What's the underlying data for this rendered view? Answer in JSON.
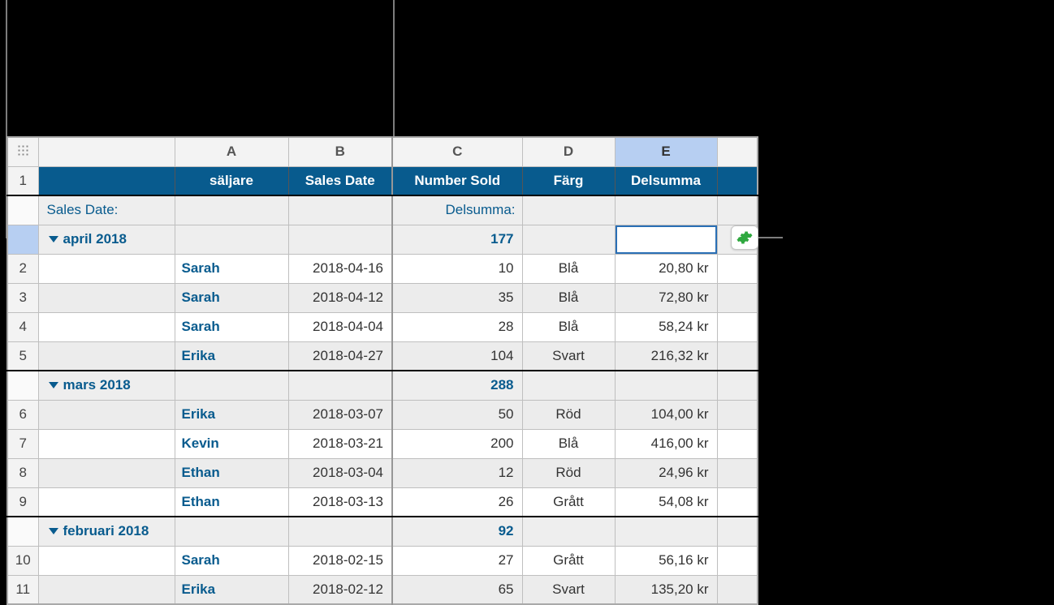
{
  "columns": {
    "letters": [
      "A",
      "B",
      "C",
      "D",
      "E"
    ],
    "selected_index": 4
  },
  "headers": {
    "label": "",
    "a": "säljare",
    "b": "Sales Date",
    "c": "Number Sold",
    "d": "Färg",
    "e": "Delsumma"
  },
  "summary_row": {
    "label": "Sales Date:",
    "sub_label": "Delsumma:"
  },
  "groups": [
    {
      "name": "april 2018",
      "subtotal_number": "177",
      "rows": [
        {
          "n": "2",
          "seller": "Sarah",
          "date": "2018-04-16",
          "num": "10",
          "color": "Blå",
          "money": "20,80 kr",
          "shade": false
        },
        {
          "n": "3",
          "seller": "Sarah",
          "date": "2018-04-12",
          "num": "35",
          "color": "Blå",
          "money": "72,80 kr",
          "shade": true
        },
        {
          "n": "4",
          "seller": "Sarah",
          "date": "2018-04-04",
          "num": "28",
          "color": "Blå",
          "money": "58,24 kr",
          "shade": false
        },
        {
          "n": "5",
          "seller": "Erika",
          "date": "2018-04-27",
          "num": "104",
          "color": "Svart",
          "money": "216,32 kr",
          "shade": true
        }
      ]
    },
    {
      "name": "mars 2018",
      "subtotal_number": "288",
      "rows": [
        {
          "n": "6",
          "seller": "Erika",
          "date": "2018-03-07",
          "num": "50",
          "color": "Röd",
          "money": "104,00 kr",
          "shade": true
        },
        {
          "n": "7",
          "seller": "Kevin",
          "date": "2018-03-21",
          "num": "200",
          "color": "Blå",
          "money": "416,00 kr",
          "shade": false
        },
        {
          "n": "8",
          "seller": "Ethan",
          "date": "2018-03-04",
          "num": "12",
          "color": "Röd",
          "money": "24,96 kr",
          "shade": true
        },
        {
          "n": "9",
          "seller": "Ethan",
          "date": "2018-03-13",
          "num": "26",
          "color": "Grått",
          "money": "54,08 kr",
          "shade": false
        }
      ]
    },
    {
      "name": "februari 2018",
      "subtotal_number": "92",
      "rows": [
        {
          "n": "10",
          "seller": "Sarah",
          "date": "2018-02-15",
          "num": "27",
          "color": "Grått",
          "money": "56,16 kr",
          "shade": false
        },
        {
          "n": "11",
          "seller": "Erika",
          "date": "2018-02-12",
          "num": "65",
          "color": "Svart",
          "money": "135,20 kr",
          "shade": true
        }
      ]
    }
  ],
  "rownum_header": "1",
  "icons": {
    "gear": "gear-icon",
    "grip": "grip-icon",
    "disclose": "chevron-down-icon"
  }
}
